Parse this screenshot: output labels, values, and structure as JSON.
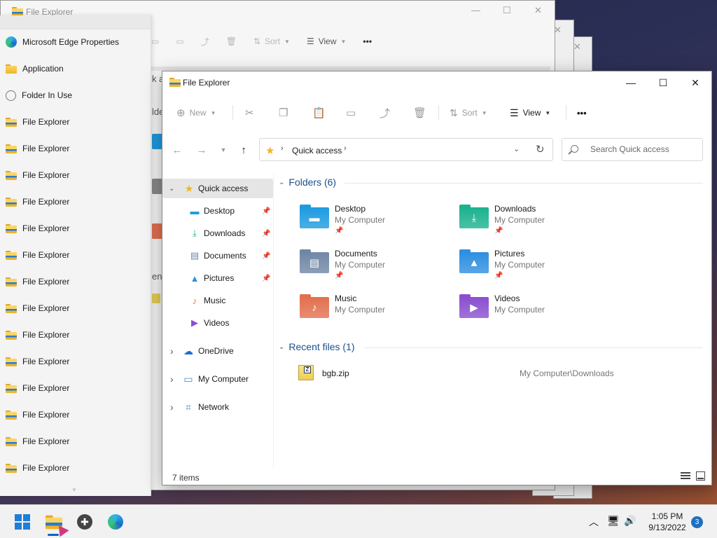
{
  "background_window": {
    "title": "File Explorer",
    "toolbar": {
      "sort_label": "Sort",
      "view_label": "View"
    },
    "fragments": [
      "k a",
      "lder",
      "ent"
    ]
  },
  "jumplist": {
    "items": [
      {
        "label": "Microsoft Edge Properties",
        "icon": "edge-icon"
      },
      {
        "label": "Application",
        "icon": "folder-icon"
      },
      {
        "label": "Folder In Use",
        "icon": "clock-icon"
      },
      {
        "label": "File Explorer",
        "icon": "explorer-icon"
      },
      {
        "label": "File Explorer",
        "icon": "explorer-icon"
      },
      {
        "label": "File Explorer",
        "icon": "explorer-icon"
      },
      {
        "label": "File Explorer",
        "icon": "explorer-icon"
      },
      {
        "label": "File Explorer",
        "icon": "explorer-icon"
      },
      {
        "label": "File Explorer",
        "icon": "explorer-icon"
      },
      {
        "label": "File Explorer",
        "icon": "explorer-icon"
      },
      {
        "label": "File Explorer",
        "icon": "explorer-icon"
      },
      {
        "label": "File Explorer",
        "icon": "explorer-icon"
      },
      {
        "label": "File Explorer",
        "icon": "explorer-icon"
      },
      {
        "label": "File Explorer",
        "icon": "explorer-icon"
      },
      {
        "label": "File Explorer",
        "icon": "explorer-icon"
      },
      {
        "label": "File Explorer",
        "icon": "explorer-icon"
      },
      {
        "label": "File Explorer",
        "icon": "explorer-icon"
      }
    ]
  },
  "window": {
    "title": "File Explorer",
    "toolbar": {
      "new_label": "New",
      "sort_label": "Sort",
      "view_label": "View",
      "more_label": "•••"
    },
    "address": {
      "crumb": "Quick access",
      "search_placeholder": "Search Quick access"
    },
    "navpane": {
      "quick_access": "Quick access",
      "pinned": [
        {
          "label": "Desktop",
          "icon": "desktop-icon",
          "pinned": true
        },
        {
          "label": "Downloads",
          "icon": "downloads-icon",
          "pinned": true
        },
        {
          "label": "Documents",
          "icon": "documents-icon",
          "pinned": true
        },
        {
          "label": "Pictures",
          "icon": "pictures-icon",
          "pinned": true
        },
        {
          "label": "Music",
          "icon": "music-icon",
          "pinned": false
        },
        {
          "label": "Videos",
          "icon": "videos-icon",
          "pinned": false
        }
      ],
      "roots": [
        {
          "label": "OneDrive",
          "icon": "onedrive-icon"
        },
        {
          "label": "My Computer",
          "icon": "computer-icon"
        },
        {
          "label": "Network",
          "icon": "network-icon"
        }
      ]
    },
    "folders_header": "Folders (6)",
    "folders": [
      {
        "name": "Desktop",
        "location": "My Computer",
        "pinned": true,
        "color": "#1e9be0"
      },
      {
        "name": "Downloads",
        "location": "My Computer",
        "pinned": true,
        "color": "#1bb28f"
      },
      {
        "name": "Documents",
        "location": "My Computer",
        "pinned": true,
        "color": "#6f87a6"
      },
      {
        "name": "Pictures",
        "location": "My Computer",
        "pinned": true,
        "color": "#2d8fe0"
      },
      {
        "name": "Music",
        "location": "My Computer",
        "pinned": false,
        "color": "#e2704f"
      },
      {
        "name": "Videos",
        "location": "My Computer",
        "pinned": false,
        "color": "#8a4fd0"
      }
    ],
    "recent_header": "Recent files (1)",
    "recent": [
      {
        "name": "bgb.zip",
        "path": "My Computer\\Downloads"
      }
    ],
    "status": "7 items"
  },
  "taskbar": {
    "clock_time": "1:05 PM",
    "clock_date": "9/13/2022",
    "notification_count": "3"
  },
  "colors": {
    "accent": "#0067c0",
    "folder_yellow": "#f0b429",
    "section_header": "#1a4f8c"
  }
}
